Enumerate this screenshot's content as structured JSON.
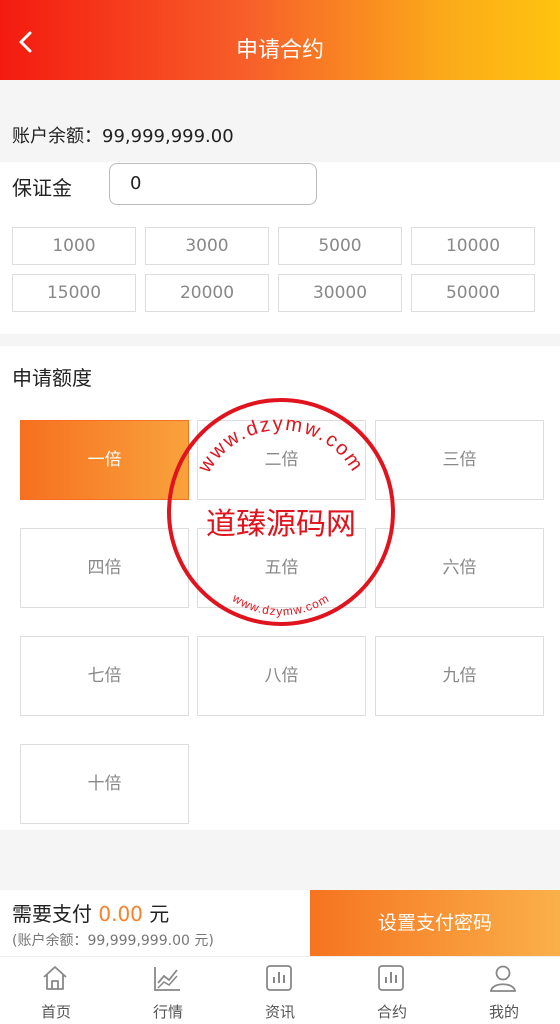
{
  "header": {
    "title": "申请合约"
  },
  "balance": {
    "text": "账户余额：99,999,999.00"
  },
  "margin": {
    "label": "保证金",
    "value": "0",
    "amounts": [
      "1000",
      "3000",
      "5000",
      "10000",
      "15000",
      "20000",
      "30000",
      "50000"
    ]
  },
  "apply": {
    "label": "申请额度",
    "multipliers": [
      "一倍",
      "二倍",
      "三倍",
      "四倍",
      "五倍",
      "六倍",
      "七倍",
      "八倍",
      "九倍",
      "十倍"
    ],
    "selected_index": 0
  },
  "pay": {
    "prefix": "需要支付",
    "amount": "0.00",
    "unit": "元",
    "balance_note": "(账户余额：99,999,999.00 元)",
    "button": "设置支付密码"
  },
  "tabs": [
    {
      "label": "首页",
      "icon": "home-icon"
    },
    {
      "label": "行情",
      "icon": "chart-trend-icon"
    },
    {
      "label": "资讯",
      "icon": "news-bars-icon"
    },
    {
      "label": "合约",
      "icon": "contract-bars-icon"
    },
    {
      "label": "我的",
      "icon": "user-icon"
    }
  ],
  "watermark": {
    "center_text": "道臻源码网",
    "top_arc": "www.dzymw.com",
    "bottom_arc": "www.dzymw.com",
    "color": "#e0141e"
  },
  "colors": {
    "accent": "#f7812a",
    "header_start": "#f41a10",
    "header_end": "#ffc40e"
  }
}
